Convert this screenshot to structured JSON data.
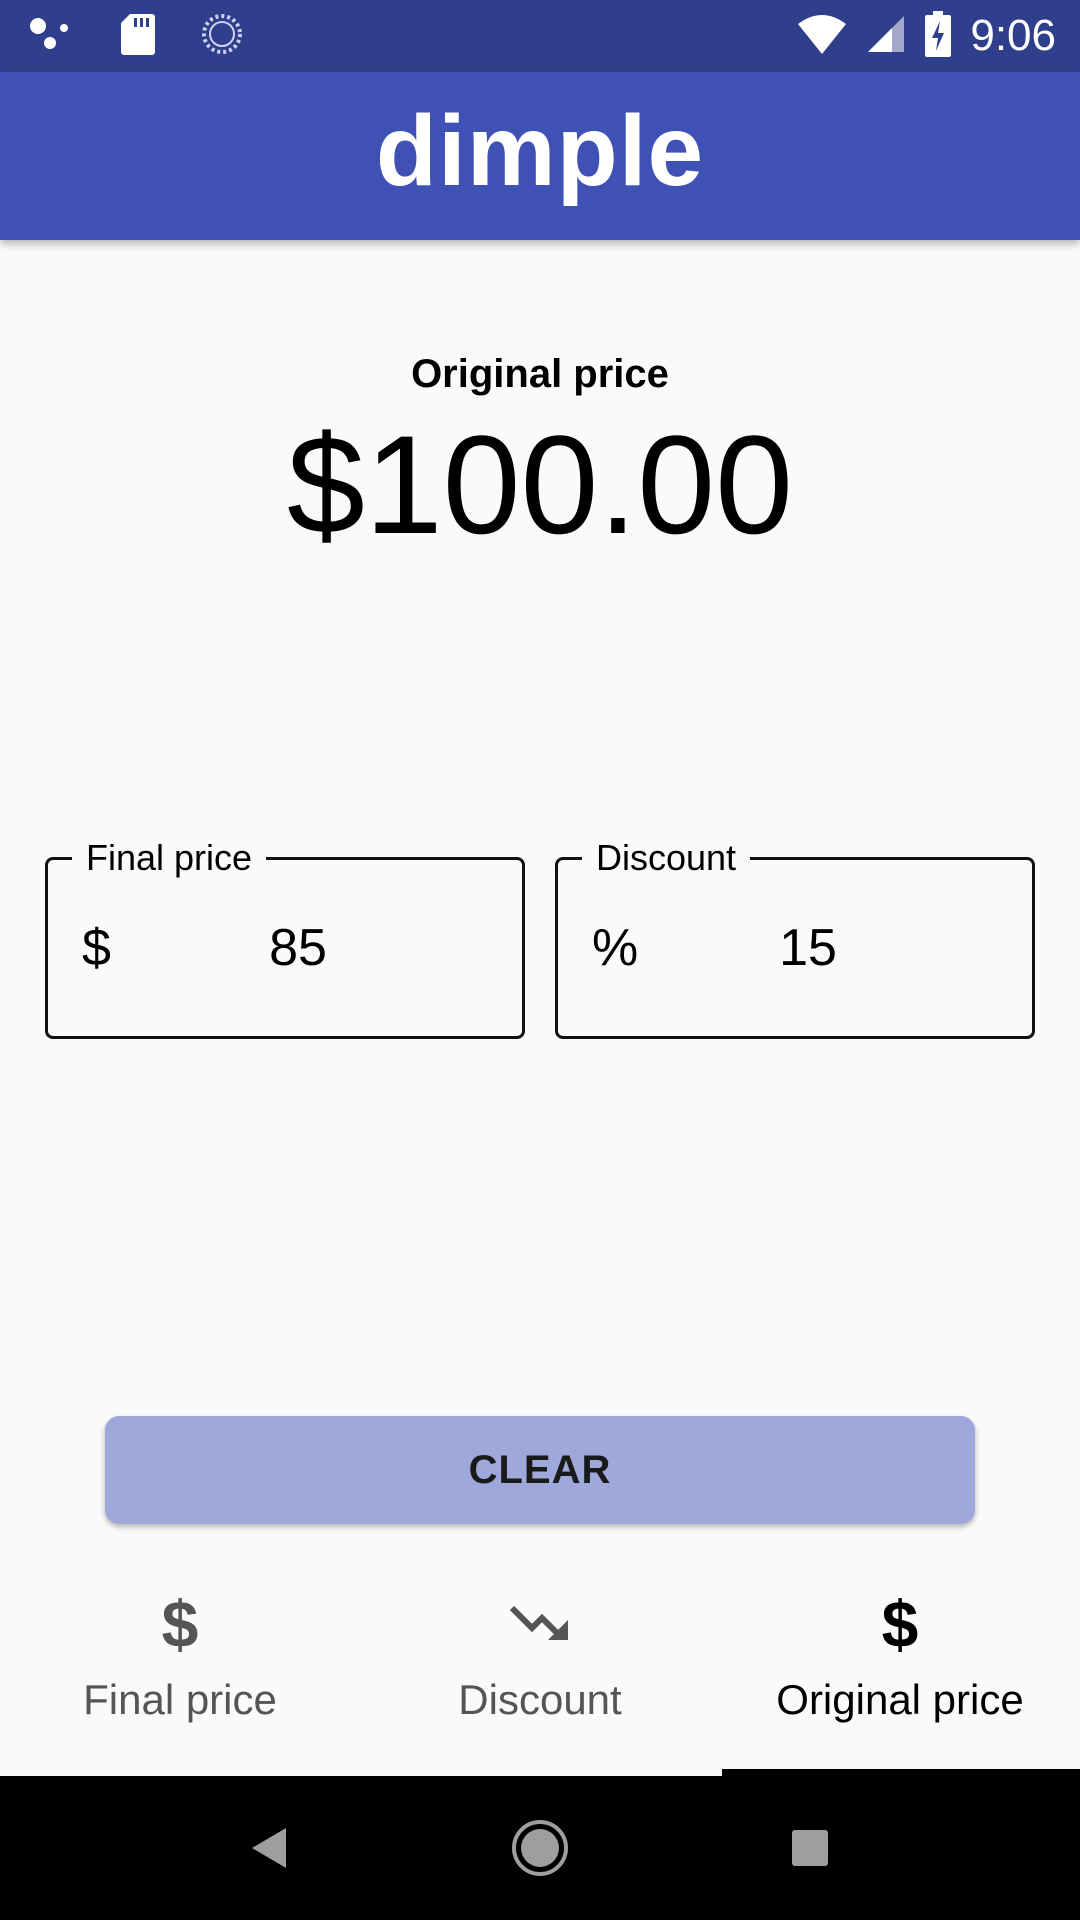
{
  "status_bar": {
    "time": "9:06",
    "icons": [
      "assistant-dots-icon",
      "sd-card-icon",
      "sync-spinner-icon",
      "wifi-icon",
      "signal-icon",
      "battery-charging-icon"
    ]
  },
  "app_bar": {
    "title": "dimple"
  },
  "result": {
    "label": "Original price",
    "value": "$100.00"
  },
  "fields": [
    {
      "legend": "Final price",
      "prefix": "$",
      "value": "85"
    },
    {
      "legend": "Discount",
      "prefix": "%",
      "value": "15"
    }
  ],
  "clear_button": {
    "label": "CLEAR"
  },
  "bottom_nav": {
    "tabs": [
      {
        "label": "Final price",
        "icon": "dollar-icon",
        "glyph": "$",
        "active": false
      },
      {
        "label": "Discount",
        "icon": "trending-down-icon",
        "active": false
      },
      {
        "label": "Original price",
        "icon": "dollar-icon",
        "glyph": "$",
        "active": true
      }
    ]
  },
  "colors": {
    "status_bar": "#303f8c",
    "app_bar": "#3f51b5",
    "clear_button": "#9fa8da",
    "background": "#fafafa",
    "system_nav": "#000000"
  }
}
